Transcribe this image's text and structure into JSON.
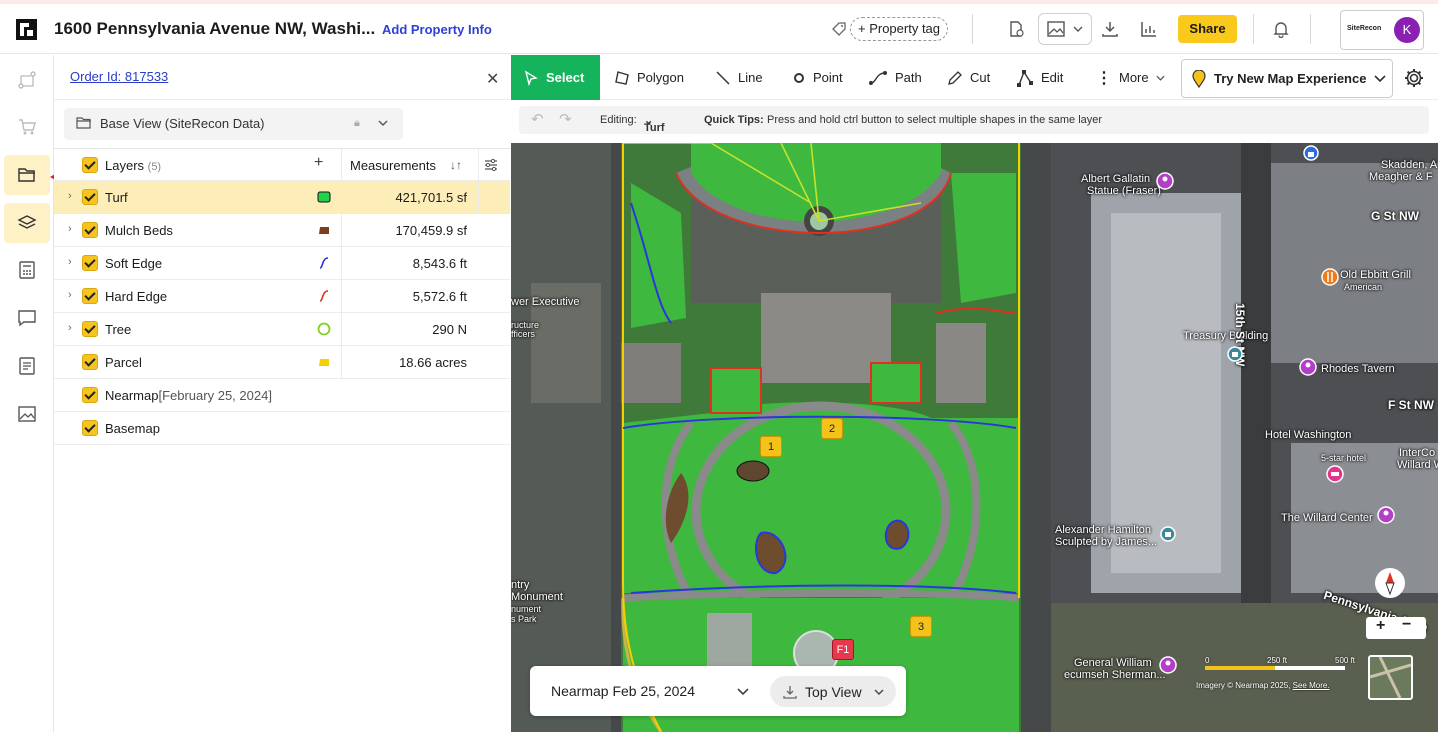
{
  "header": {
    "address": "1600 Pennsylvania Avenue NW, Washi...",
    "add_property_info": "Add Property Info",
    "property_tag": "+ Property tag",
    "share": "Share",
    "brand": "SiteRecon",
    "avatar_initial": "K"
  },
  "panel": {
    "order_id": "Order Id: 817533",
    "base_view": "Base View (SiteRecon Data)",
    "layers_header": "Layers",
    "layers_count": "(5)",
    "measurements_header": "Measurements",
    "layers": [
      {
        "name": "Turf",
        "measurement": "421,701.5 sf",
        "symbol_color": "#22d24a"
      },
      {
        "name": "Mulch Beds",
        "measurement": "170,459.9 sf",
        "symbol_color": "#7a3f1d"
      },
      {
        "name": "Soft Edge",
        "measurement": "8,543.6 ft",
        "symbol_color": "#2b35e0"
      },
      {
        "name": "Hard Edge",
        "measurement": "5,572.6 ft",
        "symbol_color": "#e0301e"
      },
      {
        "name": "Tree",
        "measurement": "290 N",
        "symbol_color": "#7ed321"
      },
      {
        "name": "Parcel",
        "measurement": "18.66 acres",
        "symbol_color": "#f4d000"
      }
    ],
    "nearmap_label": "Nearmap",
    "nearmap_date": "[February 25, 2024]",
    "basemap_label": "Basemap"
  },
  "toolbar": {
    "select": "Select",
    "polygon": "Polygon",
    "line": "Line",
    "point": "Point",
    "path": "Path",
    "cut": "Cut",
    "edit": "Edit",
    "more": "More",
    "try_new": "Try New Map Experience",
    "editing_label": "Editing:",
    "editing_value": "Turf",
    "quick_tips_label": "Quick Tips:",
    "quick_tips": "Press and hold ctrl button to select multiple shapes in the same layer"
  },
  "map": {
    "labels": {
      "albert": "Albert Gallatin",
      "albert2": "Statue (Fraser)",
      "gst": "G St NW",
      "skadden": "Skadden, A",
      "meagher": "Meagher & F",
      "oldebbitt": "Old Ebbitt Grill",
      "american": "American",
      "treasury": "Treasury Building",
      "st15": "15th St NW",
      "rhodes": "Rhodes Tavern",
      "fst": "F St NW",
      "hotelwash": "Hotel Washington",
      "hotelstars": "5-star hotel",
      "intercon": "InterCo",
      "willard": "Willard W",
      "willardctr": "The Willard Center",
      "hamilton": "Alexander Hamilton",
      "hamilton2": "Sculpted by James...",
      "penn": "Pennsylvania Aven",
      "sherman": "General William",
      "sherman2": "ecumseh Sherman...",
      "exec": "wer Executive",
      "exec2": "ructure",
      "exec3": "fficers",
      "entry": "ntry",
      "monument": "Monument",
      "nument": "nument",
      "park": "s Park"
    },
    "pins": [
      "1",
      "2",
      "3",
      "F1"
    ],
    "nearmap_date": "Nearmap Feb 25, 2024",
    "view_mode": "Top View",
    "scale_0": "0",
    "scale_250": "250 ft",
    "scale_500": "500 ft",
    "credit": "Imagery © Nearmap 2025,",
    "see_more": "See More."
  }
}
